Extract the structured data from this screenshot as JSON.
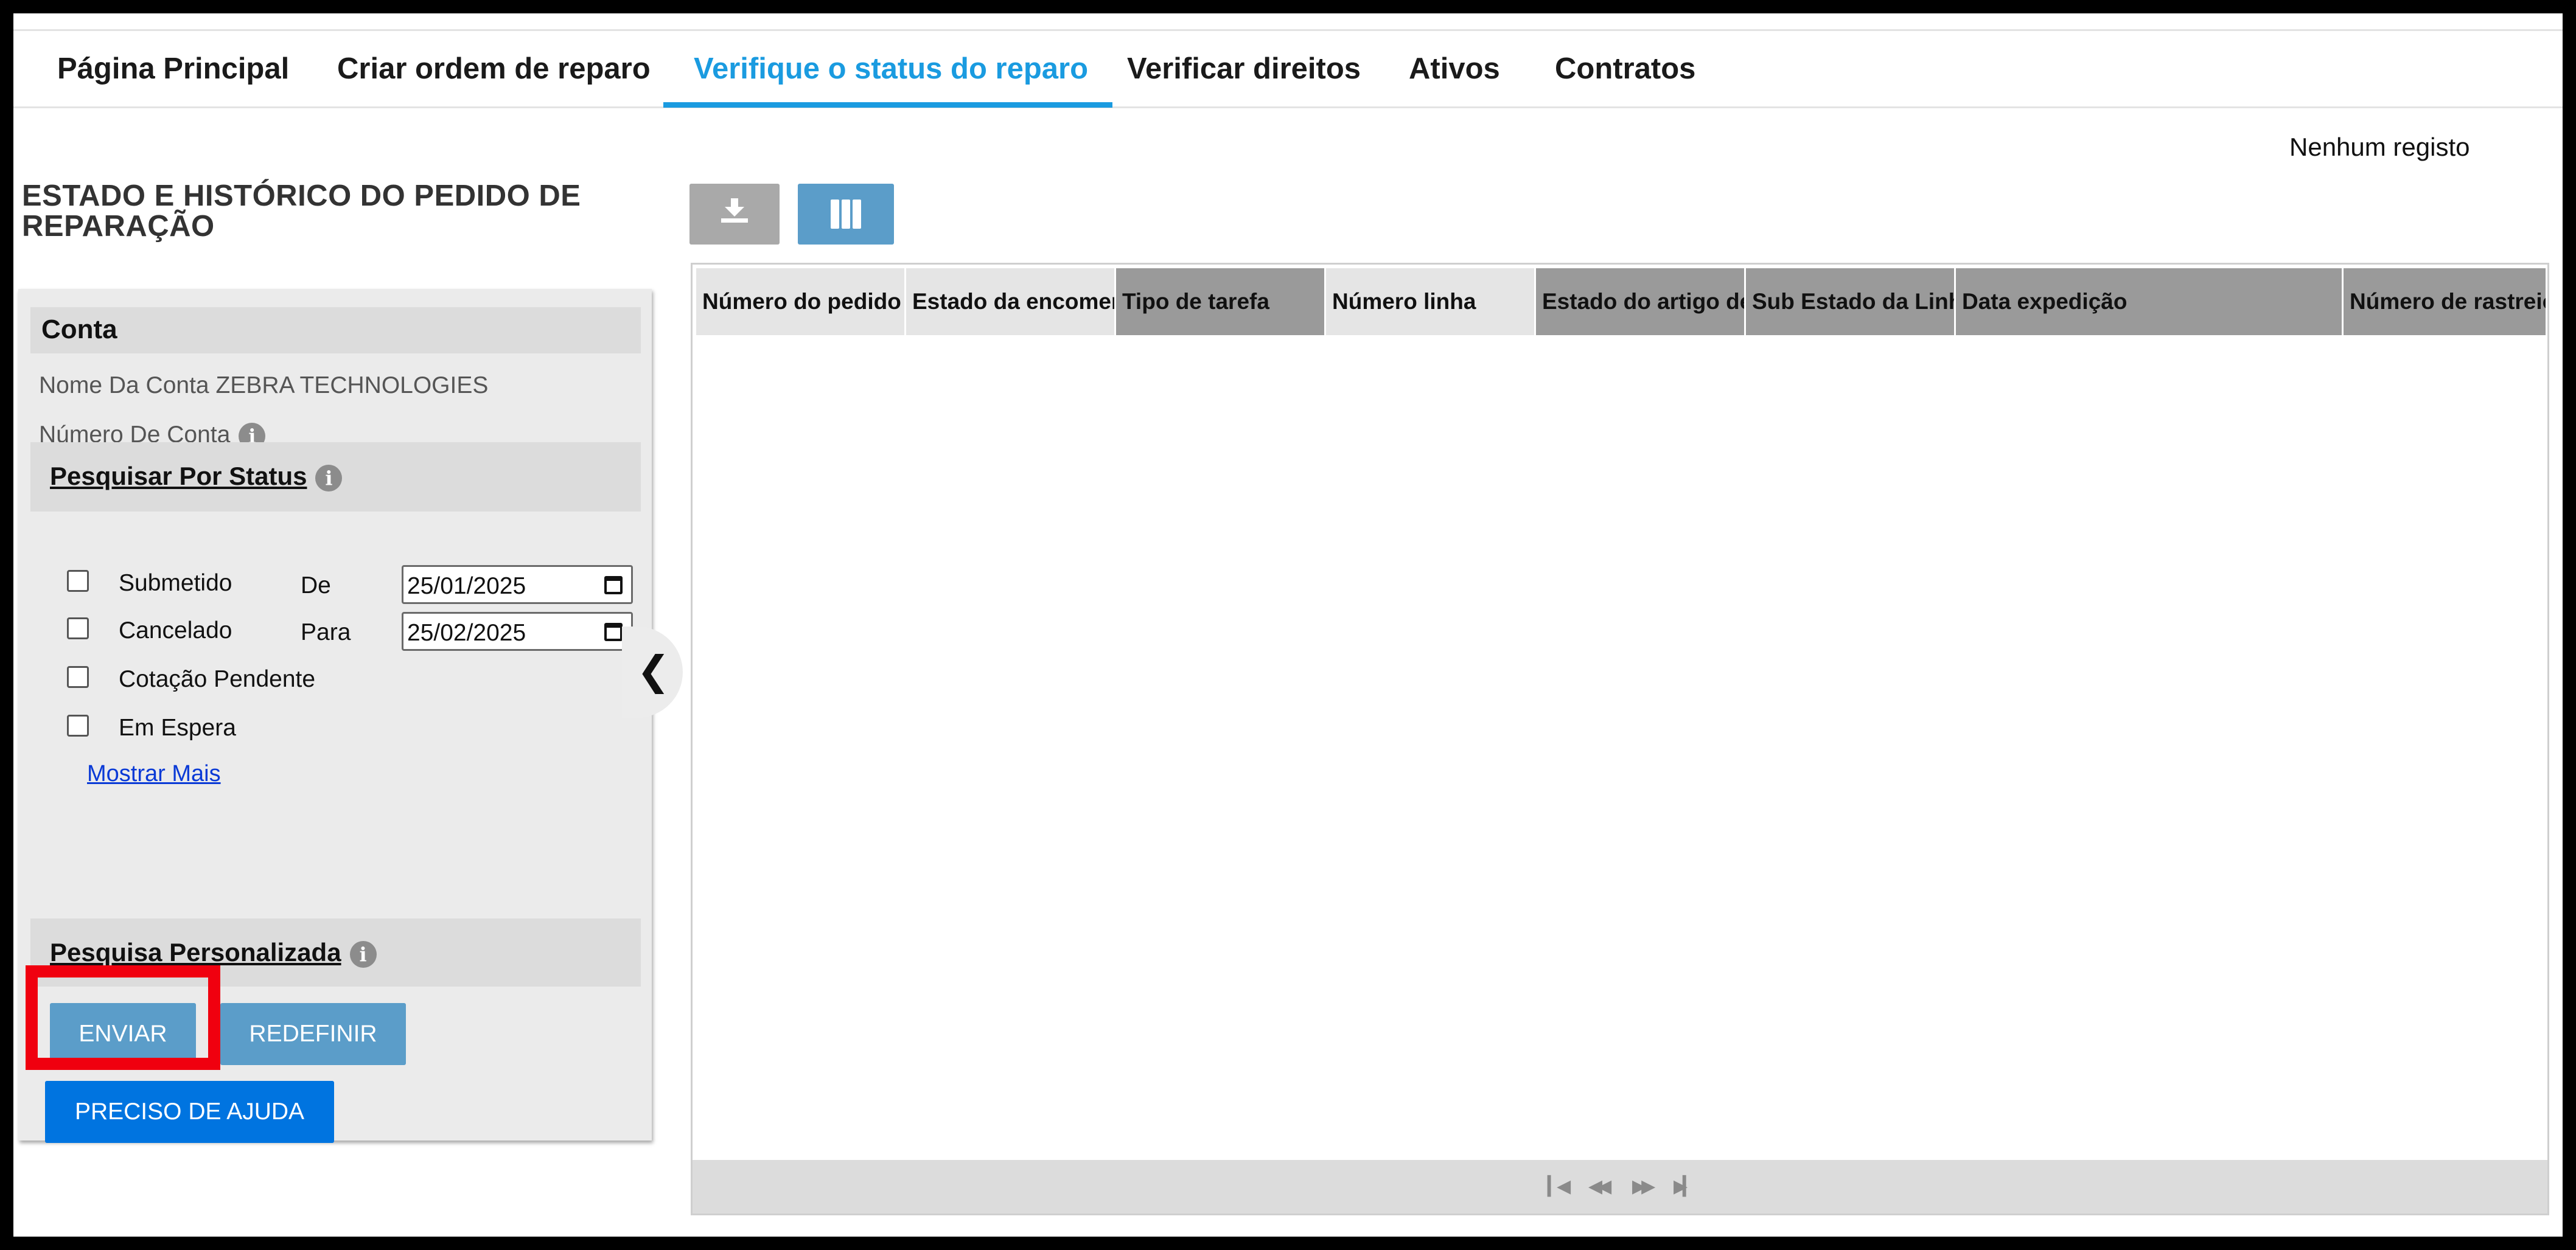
{
  "nav": {
    "tabs": [
      {
        "label": "Página Principal"
      },
      {
        "label": "Criar ordem de reparo"
      },
      {
        "label": "Verifique o status do reparo"
      },
      {
        "label": "Verificar direitos"
      },
      {
        "label": "Ativos"
      },
      {
        "label": "Contratos"
      }
    ],
    "active_tab": "Verifique o status do reparo"
  },
  "page": {
    "title": "ESTADO E HISTÓRICO DO PEDIDO DE REPARAÇÃO"
  },
  "account": {
    "section_title": "Conta",
    "name_label": "Nome Da Conta",
    "name_value": "ZEBRA TECHNOLOGIES",
    "number_label": "Número De Conta"
  },
  "status_search": {
    "title": "Pesquisar Por Status",
    "options": [
      {
        "label": "Submetido",
        "checked": false
      },
      {
        "label": "Cancelado",
        "checked": false
      },
      {
        "label": "Cotação Pendente",
        "checked": false
      },
      {
        "label": "Em Espera",
        "checked": false
      }
    ],
    "from_label": "De",
    "from_value": "25/01/2025",
    "to_label": "Para",
    "to_value": "25/02/2025",
    "show_more": "Mostrar Mais"
  },
  "custom_search": {
    "title": "Pesquisa Personalizada"
  },
  "buttons": {
    "submit": "ENVIAR",
    "reset": "REDEFINIR",
    "help": "PRECISO DE AJUDA"
  },
  "results": {
    "record_count": "Nenhum registo",
    "columns": [
      "Número do pedido",
      "Estado da encomenda",
      "Tipo de tarefa",
      "Número linha",
      "Estado do artigo de linha",
      "Sub Estado da Linha",
      "Data expedição",
      "Número de rastreio"
    ]
  },
  "colors": {
    "accent": "#1a9be0",
    "button": "#5b9dc9",
    "help_button": "#0074e0",
    "highlight": "#f0000f"
  }
}
